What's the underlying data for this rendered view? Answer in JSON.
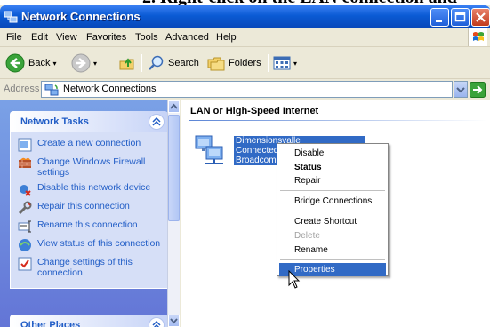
{
  "window": {
    "title": "Network Connections"
  },
  "menubar": {
    "items": [
      "File",
      "Edit",
      "View",
      "Favorites",
      "Tools",
      "Advanced",
      "Help"
    ]
  },
  "toolbar": {
    "back_label": "Back",
    "search_label": "Search",
    "folders_label": "Folders"
  },
  "address": {
    "label": "Address",
    "value": "Network Connections",
    "go_label": "Go"
  },
  "tasks_panel": {
    "title": "Network Tasks",
    "items": [
      {
        "label": "Create a new connection",
        "icon": "new-connection-icon"
      },
      {
        "label": "Change Windows Firewall settings",
        "icon": "firewall-icon"
      },
      {
        "label": "Disable this network device",
        "icon": "disable-device-icon"
      },
      {
        "label": "Repair this connection",
        "icon": "repair-icon"
      },
      {
        "label": "Rename this connection",
        "icon": "rename-icon"
      },
      {
        "label": "View status of this connection",
        "icon": "status-icon"
      },
      {
        "label": "Change settings of this connection",
        "icon": "settings-icon"
      }
    ]
  },
  "other_places": {
    "title": "Other Places"
  },
  "main": {
    "group_title": "LAN or High-Speed Internet",
    "connection": {
      "name": "Dimensionsvalle",
      "status": "Connected",
      "device": "Broadcom N"
    }
  },
  "context_menu": {
    "items": [
      {
        "label": "Disable",
        "style": "normal"
      },
      {
        "label": "Status",
        "style": "bold"
      },
      {
        "label": "Repair",
        "style": "normal"
      },
      {
        "label": "Bridge Connections",
        "style": "normal"
      },
      {
        "label": "Create Shortcut",
        "style": "normal"
      },
      {
        "label": "Delete",
        "style": "disabled"
      },
      {
        "label": "Rename",
        "style": "normal"
      },
      {
        "label": "Properties",
        "style": "highlighted"
      }
    ]
  },
  "colors": {
    "title_bar": "#0a5ad4",
    "selection": "#316ac5",
    "task_link": "#215dc6"
  }
}
